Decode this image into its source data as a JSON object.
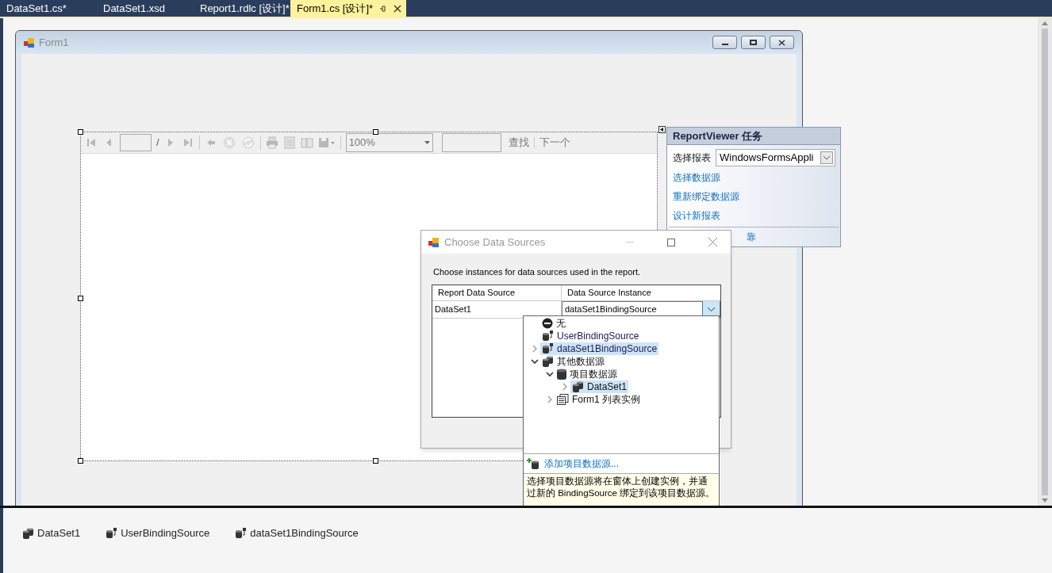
{
  "tabs": [
    {
      "label": "DataSet1.cs*",
      "selected": false
    },
    {
      "label": "DataSet1.xsd",
      "selected": false
    },
    {
      "label": "Report1.rdlc [设计]*",
      "selected": false
    },
    {
      "label": "Form1.cs [设计]*",
      "selected": true
    }
  ],
  "form": {
    "title": "Form1"
  },
  "report_toolbar": {
    "separator": "/",
    "zoom": "100%",
    "find_link": "查找",
    "next_link": "下一个"
  },
  "tasks_panel": {
    "title": "ReportViewer 任务",
    "choose_report_label": "选择报表",
    "choose_report_value": "WindowsFormsAppli",
    "links": [
      "选择数据源",
      "重新绑定数据源",
      "设计新报表"
    ],
    "partial_link": "靠"
  },
  "dialog": {
    "title": "Choose Data Sources",
    "instruction": "Choose instances for data sources used in the report.",
    "columns": [
      "Report Data Source",
      "Data Source Instance"
    ],
    "rows": [
      {
        "report_source": "DataSet1",
        "instance": "dataSet1BindingSource"
      }
    ]
  },
  "dropdown": {
    "tree": [
      {
        "label": "无",
        "kind": "none",
        "selected": false
      },
      {
        "label": "UserBindingSource",
        "kind": "binding",
        "selected": false
      },
      {
        "label": "dataSet1BindingSource",
        "kind": "binding",
        "selected": true,
        "expanded": false
      },
      {
        "label": "其他数据源",
        "kind": "datasets",
        "selected": false,
        "expanded": true,
        "children": [
          {
            "label": "项目数据源",
            "kind": "database",
            "selected": false,
            "expanded": true,
            "children": [
              {
                "label": "DataSet1",
                "kind": "datasets",
                "selected": true,
                "expanded": false
              }
            ]
          },
          {
            "label": "Form1 列表实例",
            "kind": "list",
            "selected": false,
            "expanded": false
          }
        ]
      }
    ],
    "add_link": "添加项目数据源...",
    "help": "选择项目数据源将在窗体上创建实例，并通过新的 BindingSource 绑定到该项目数据源。"
  },
  "component_tray": [
    {
      "label": "DataSet1",
      "kind": "datasets"
    },
    {
      "label": "UserBindingSource",
      "kind": "binding"
    },
    {
      "label": "dataSet1BindingSource",
      "kind": "binding"
    }
  ]
}
